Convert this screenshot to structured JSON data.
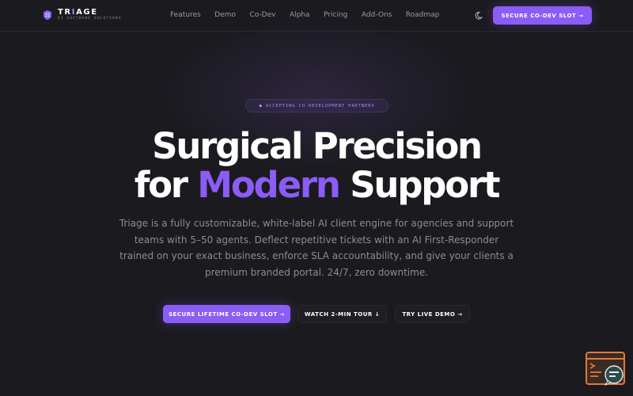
{
  "brand": {
    "name_prefix": "TR",
    "name_accent": "I",
    "name_suffix": "AGE",
    "tagline": "AI SOFTWARE SOLUTIONS",
    "logo_icon": "puzzle-shield-icon"
  },
  "nav": {
    "items": [
      "Features",
      "Demo",
      "Co-Dev",
      "Alpha",
      "Pricing",
      "Add-Ons",
      "Roadmap"
    ]
  },
  "header": {
    "theme_toggle_icon": "moon-icon",
    "cta_label": "SECURE CO-DEV SLOT →"
  },
  "hero": {
    "badge": "● ACCEPTING CO-DEVELOPMENT PARTNERS",
    "headline_line1": "Surgical Precision",
    "headline_line2_pre": "for ",
    "headline_line2_accent": "Modern",
    "headline_line2_post": " Support",
    "description": "Triage is a fully customizable, white-label AI client engine for agencies and support teams with 5–50 agents. Deflect repetitive tickets with an AI First-Responder trained on your exact business, enforce SLA accountability, and give your clients a premium branded portal. 24/7, zero downtime.",
    "buttons": {
      "primary": "SECURE LIFETIME CO-DEV SLOT →",
      "watch": "WATCH 2-MIN TOUR ↓",
      "demo": "TRY LIVE DEMO →"
    }
  },
  "widget": {
    "icon": "terminal-chat-widget-icon"
  },
  "colors": {
    "background": "#1b1a1f",
    "accent": "#8b5cf6",
    "accent_light": "#a78bfa",
    "text_muted": "#8e8a98"
  }
}
